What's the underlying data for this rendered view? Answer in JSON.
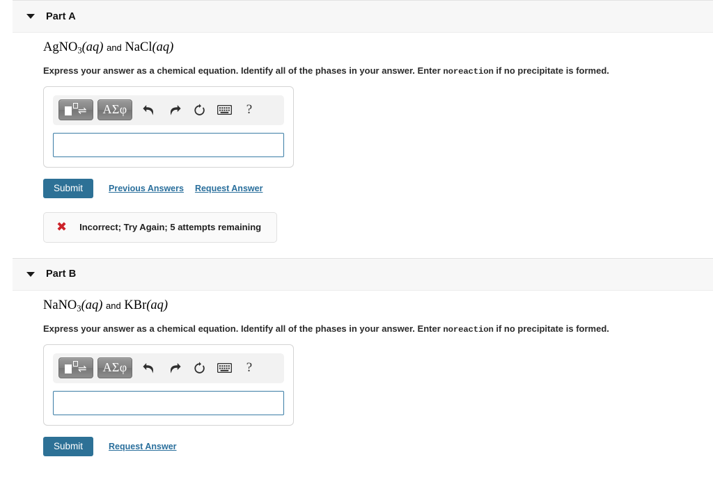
{
  "parts": [
    {
      "id": "part-a",
      "title": "Part A",
      "caret": "caret-down-icon",
      "formula": {
        "reactant1_main": "AgNO",
        "reactant1_sub": "3",
        "reactant1_phase": "(aq)",
        "conjunction": "and",
        "reactant2_main": "NaCl",
        "reactant2_phase": "(aq)",
        "plain": "AgNO3(aq) and NaCl(aq)"
      },
      "instructions": {
        "before": "Express your answer as a chemical equation. Identify all of the phases in your answer. Enter ",
        "mono": "noreaction",
        "after": " if no precipitate is formed."
      },
      "toolbar": {
        "template_button": "chemical-template-icon",
        "greek_button": "ΑΣφ",
        "undo": "undo-icon",
        "redo": "redo-icon",
        "reset": "reset-icon",
        "keyboard": "keyboard-icon",
        "help": "?"
      },
      "answer_value": "",
      "answer_placeholder": "",
      "submit_label": "Submit",
      "links": [
        "Previous Answers",
        "Request Answer"
      ],
      "feedback": {
        "icon": "x-mark-icon",
        "text": "Incorrect; Try Again; 5 attempts remaining"
      }
    },
    {
      "id": "part-b",
      "title": "Part B",
      "caret": "caret-down-icon",
      "formula": {
        "reactant1_main": "NaNO",
        "reactant1_sub": "3",
        "reactant1_phase": "(aq)",
        "conjunction": "and",
        "reactant2_main": "KBr",
        "reactant2_phase": "(aq)",
        "plain": "NaNO3(aq) and KBr(aq)"
      },
      "instructions": {
        "before": "Express your answer as a chemical equation. Identify all of the phases in your answer. Enter ",
        "mono": "noreaction",
        "after": " if no precipitate is formed."
      },
      "toolbar": {
        "template_button": "chemical-template-icon",
        "greek_button": "ΑΣφ",
        "undo": "undo-icon",
        "redo": "redo-icon",
        "reset": "reset-icon",
        "keyboard": "keyboard-icon",
        "help": "?"
      },
      "answer_value": "",
      "answer_placeholder": "",
      "submit_label": "Submit",
      "links": [
        "Request Answer"
      ],
      "feedback": null
    }
  ],
  "colors": {
    "submit_blue": "#2d7196",
    "link_blue": "#2a6f9c",
    "input_border_blue": "#3a7ca5",
    "error_red": "#cc2229",
    "header_bg": "#f7f7f7",
    "toolbar_bg": "#f2f2f2"
  }
}
